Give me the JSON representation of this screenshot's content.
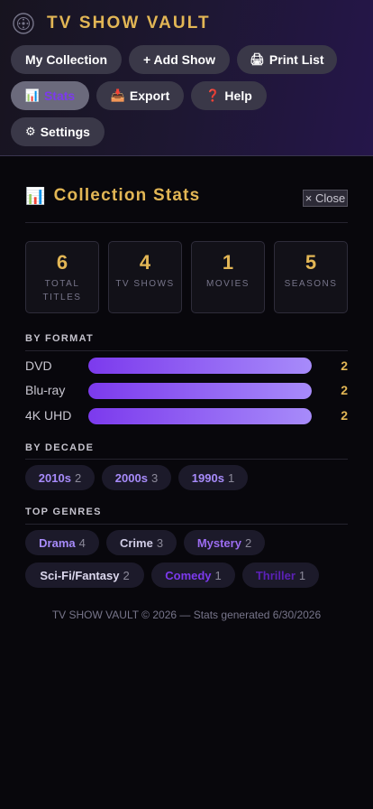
{
  "app": {
    "title": "TV SHOW VAULT"
  },
  "nav": {
    "buttons": [
      {
        "label": "My Collection",
        "icon": ""
      },
      {
        "label": "+ Add Show",
        "icon": ""
      },
      {
        "label": "Print List",
        "icon": "🖨"
      },
      {
        "label": "Stats",
        "icon": "📊",
        "active": true
      },
      {
        "label": "Export",
        "icon": "📥"
      },
      {
        "label": "Help",
        "icon": "❓"
      },
      {
        "label": "Settings",
        "icon": "⚙"
      }
    ]
  },
  "stats_panel": {
    "title": "Collection Stats",
    "title_icon": "📊",
    "close_label": "× Close",
    "cards": [
      {
        "value": "6",
        "label": "TOTAL TITLES"
      },
      {
        "value": "4",
        "label": "TV SHOWS"
      },
      {
        "value": "1",
        "label": "MOVIES"
      },
      {
        "value": "5",
        "label": "SEASONS"
      }
    ],
    "by_format": {
      "label": "BY FORMAT",
      "rows": [
        {
          "name": "DVD",
          "count": "2",
          "fill": 1.0
        },
        {
          "name": "Blu-ray",
          "count": "2",
          "fill": 1.0
        },
        {
          "name": "4K UHD",
          "count": "2",
          "fill": 1.0
        }
      ]
    },
    "by_decade": {
      "label": "BY DECADE",
      "chips": [
        {
          "name": "2010s",
          "count": "2"
        },
        {
          "name": "2000s",
          "count": "3"
        },
        {
          "name": "1990s",
          "count": "1"
        }
      ]
    },
    "top_genres": {
      "label": "TOP GENRES",
      "chips": [
        {
          "name": "Drama",
          "count": "4",
          "color": "#a78bfa"
        },
        {
          "name": "Crime",
          "count": "3",
          "color": "#d0cce6"
        },
        {
          "name": "Mystery",
          "count": "2",
          "color": "#9b6cf0"
        },
        {
          "name": "Sci-Fi/Fantasy",
          "count": "2",
          "color": "#dcd8ee"
        },
        {
          "name": "Comedy",
          "count": "1",
          "color": "#7c3aed"
        },
        {
          "name": "Thriller",
          "count": "1",
          "color": "#5b21b6"
        }
      ]
    }
  },
  "footer": {
    "text": "TV SHOW VAULT © 2026 — Stats generated 6/30/2026"
  },
  "colors": {
    "accent_gold": "#e2b655",
    "accent_purple": "#7c3aed",
    "bar_end": "#a78bfa"
  },
  "icons": {
    "logo": "film-reel-icon"
  }
}
